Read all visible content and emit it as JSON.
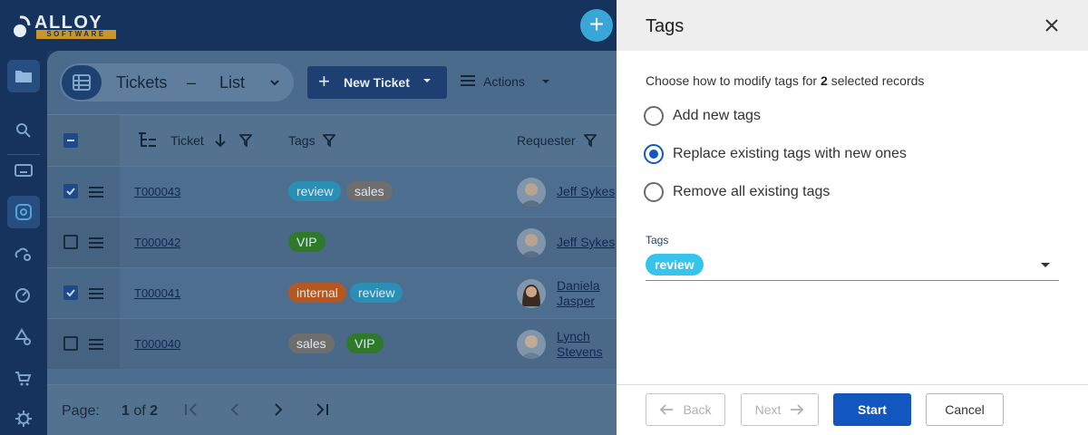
{
  "app": {
    "logo_text": "ALLOY",
    "logo_sub": "SOFTWARE",
    "accent": "#3aa6d8",
    "brand_gold": "#c9962a",
    "fab_label": "+"
  },
  "sidebar": {
    "items": [
      {
        "name": "folder-icon",
        "active": true
      },
      {
        "name": "search-icon",
        "active": false
      },
      {
        "name": "ticket-icon",
        "active": false
      },
      {
        "name": "service-icon",
        "active": true
      },
      {
        "name": "cloud-gear-icon",
        "active": false
      },
      {
        "name": "dashboard-gear-icon",
        "active": false
      },
      {
        "name": "shapes-gear-icon",
        "active": false
      },
      {
        "name": "cart-gear-icon",
        "active": false
      },
      {
        "name": "virus-icon",
        "active": false
      }
    ]
  },
  "header": {
    "title": "Tickets",
    "separator": "–",
    "view": "List",
    "new_ticket": "New Ticket",
    "new_ticket_plus": "+",
    "actions": "Actions"
  },
  "table": {
    "columns": [
      "Ticket",
      "Tags",
      "Requester"
    ],
    "rows": [
      {
        "id": "T000043",
        "selected": true,
        "tags": [
          {
            "label": "review",
            "color": "#2a8fb5"
          },
          {
            "label": "sales",
            "color": "#6e6e6e"
          }
        ],
        "requester": "Jeff Sykes"
      },
      {
        "id": "T000042",
        "selected": false,
        "tags": [
          {
            "label": "VIP",
            "color": "#2e7a2a"
          }
        ],
        "requester": "Jeff Sykes"
      },
      {
        "id": "T000041",
        "selected": true,
        "tags": [
          {
            "label": "internal",
            "color": "#b5581f"
          },
          {
            "label": "review",
            "color": "#2a8fb5"
          }
        ],
        "requester": "Daniela Jasper",
        "requester_lines": [
          "Daniela",
          "Jasper"
        ]
      },
      {
        "id": "T000040",
        "selected": false,
        "tags": [
          {
            "label": "sales",
            "color": "#6e6e6e"
          },
          {
            "label": "VIP",
            "color": "#2e7a2a"
          }
        ],
        "requester": "Lynch Stevens",
        "requester_lines": [
          "Lynch",
          "Stevens"
        ]
      }
    ]
  },
  "pager": {
    "label": "Page:",
    "current": "1",
    "of_text": "of",
    "total": "2"
  },
  "dialog": {
    "title": "Tags",
    "description_prefix": "Choose how to modify tags for",
    "selected_count": "2",
    "description_suffix": "selected records",
    "options": [
      {
        "label": "Add new tags",
        "selected": false
      },
      {
        "label": "Replace existing tags with new ones",
        "selected": true
      },
      {
        "label": "Remove all existing tags",
        "selected": false
      }
    ],
    "field_label": "Tags",
    "field_value": "review",
    "field_chip_color": "#36c3ec",
    "buttons": {
      "back": "Back",
      "next": "Next",
      "start": "Start",
      "cancel": "Cancel"
    },
    "primary_color": "#1257c0"
  }
}
